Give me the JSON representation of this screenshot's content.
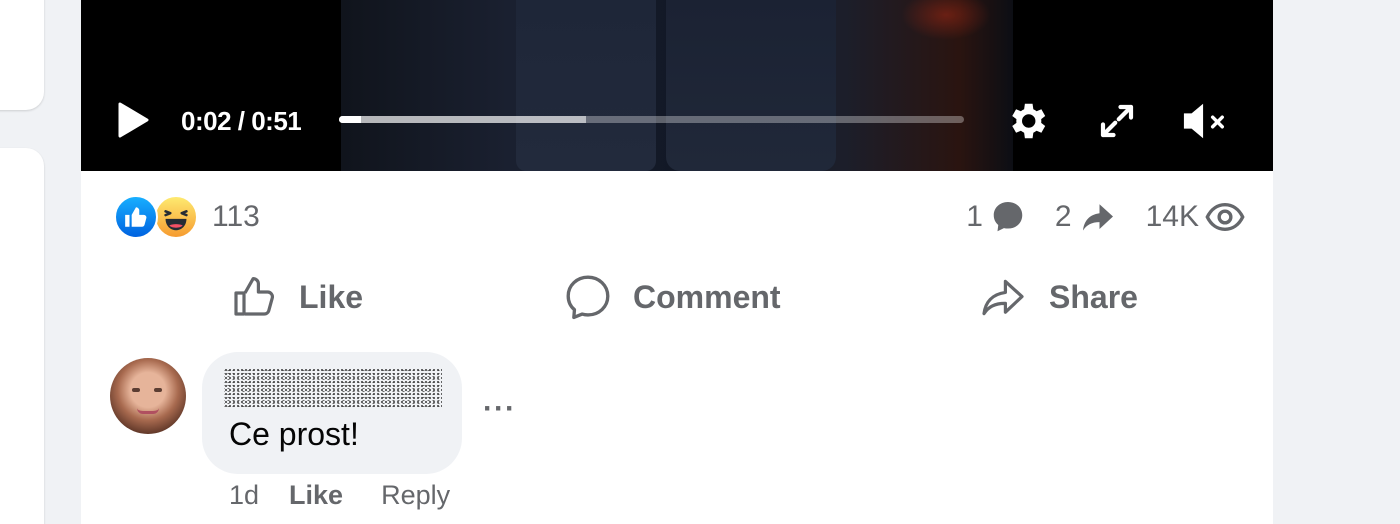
{
  "video": {
    "current_time": "0:02",
    "duration": "0:51",
    "time_separator": " / ",
    "played_fraction": 0.035,
    "buffered_fraction": 0.395,
    "muted": true
  },
  "reactions": {
    "count": "113",
    "types": [
      "like",
      "haha"
    ]
  },
  "stats": {
    "comments": "1",
    "shares": "2",
    "views": "14K"
  },
  "actions": {
    "like": "Like",
    "comment": "Comment",
    "share": "Share"
  },
  "comment": {
    "author": "",
    "text": "Ce prost!",
    "time": "1d",
    "like_label": "Like",
    "reply_label": "Reply",
    "more_label": "···"
  },
  "colors": {
    "like_blue": "#0866ff",
    "secondary_text": "#65676b",
    "bubble_bg": "#f0f2f5",
    "page_bg": "#f0f2f5"
  },
  "icons": [
    "play-icon",
    "settings-gear-icon",
    "fullscreen-icon",
    "volume-muted-icon",
    "comment-bubble-icon",
    "share-arrow-icon",
    "eye-icon",
    "thumbs-up-icon"
  ]
}
